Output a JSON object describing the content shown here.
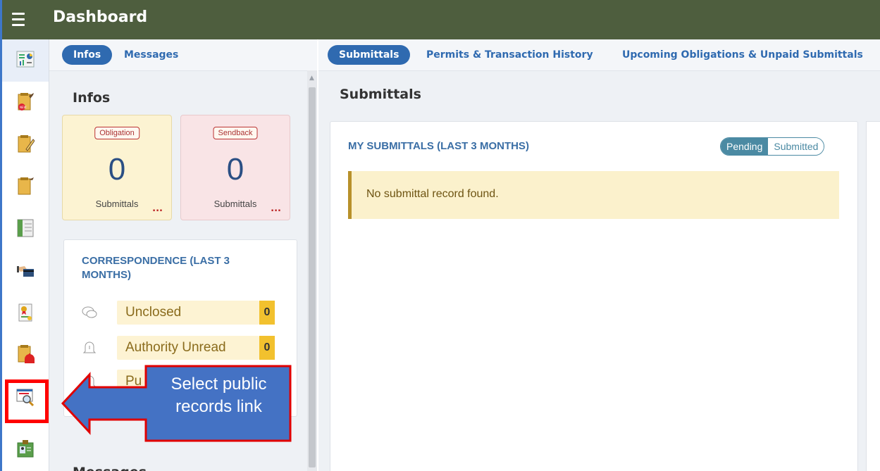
{
  "header": {
    "title": "Dashboard"
  },
  "rail": {
    "items": [
      {
        "name": "dashboard-chart-icon",
        "active": true
      },
      {
        "name": "new-submittal-icon",
        "active": false
      },
      {
        "name": "edit-submittal-icon",
        "active": false
      },
      {
        "name": "submittal-list-icon",
        "active": false
      },
      {
        "name": "ledger-icon",
        "active": false
      },
      {
        "name": "payment-card-icon",
        "active": false
      },
      {
        "name": "certificate-icon",
        "active": false
      },
      {
        "name": "alarm-document-icon",
        "active": false
      },
      {
        "name": "public-records-search-icon",
        "active": false
      },
      {
        "name": "id-badge-icon",
        "active": false
      }
    ]
  },
  "left_panel": {
    "tabs": [
      "Infos",
      "Messages"
    ],
    "infos_title": "Infos",
    "obligation": {
      "tag": "Obligation",
      "count": "0",
      "label": "Submittals",
      "more": "..."
    },
    "sendback": {
      "tag": "Sendback",
      "count": "0",
      "label": "Submittals",
      "more": "..."
    },
    "correspondence": {
      "title": "CORRESPONDENCE (LAST 3 MONTHS)",
      "rows": [
        {
          "label": "Unclosed",
          "count": "0",
          "icon": "chat-bubbles-icon"
        },
        {
          "label": "Authority Unread",
          "count": "0",
          "icon": "bell-alert-icon"
        },
        {
          "label": "Pu",
          "count": "",
          "icon": "bell-alert-icon"
        }
      ]
    },
    "messages_title": "Messages"
  },
  "right_panel": {
    "tabs": [
      "Submittals",
      "Permits & Transaction History",
      "Upcoming Obligations & Unpaid Submittals"
    ],
    "section_title": "Submittals",
    "card_title": "MY SUBMITTALS (LAST 3 MONTHS)",
    "toggle": {
      "on": "Pending",
      "off": "Submitted"
    },
    "empty_message": "No submittal record found."
  },
  "callout": {
    "line1": "Select public",
    "line2": "records link",
    "color": "#4472c4",
    "border_color": "#e00000"
  },
  "colors": {
    "topbar": "#4e5e3e",
    "primary": "#2f6ab0",
    "card_heading": "#3a6ea5",
    "count_badge": "#f2c12e"
  }
}
